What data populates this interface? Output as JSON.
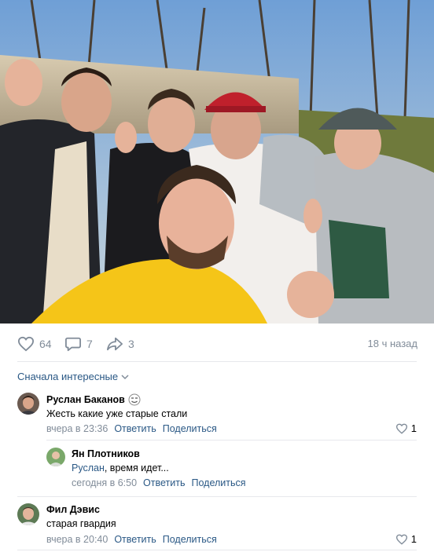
{
  "post": {
    "photo_alt": "Group selfie of five friends outdoors",
    "likes": "64",
    "comments": "7",
    "shares": "3",
    "time": "18 ч назад"
  },
  "comments_section": {
    "sort_label": "Сначала интересные"
  },
  "comments": [
    {
      "author": "Руслан Баканов",
      "text": "Жесть какие уже старые стали",
      "time": "вчера в 23:36",
      "reply_label": "Ответить",
      "share_label": "Поделиться",
      "likes": "1"
    },
    {
      "author": "Ян Плотников",
      "mention": "Руслан",
      "text": ", время идет...",
      "time": "сегодня в 6:50",
      "reply_label": "Ответить",
      "share_label": "Поделиться"
    },
    {
      "author": "Фил Дэвис",
      "text": "старая гвардия",
      "time": "вчера в 20:40",
      "reply_label": "Ответить",
      "share_label": "Поделиться",
      "likes": "1"
    }
  ],
  "colors": {
    "link": "#2a5885",
    "secondary": "#818c99",
    "divider": "#e7e8ec",
    "accent_blue": "#3f8ae0"
  }
}
